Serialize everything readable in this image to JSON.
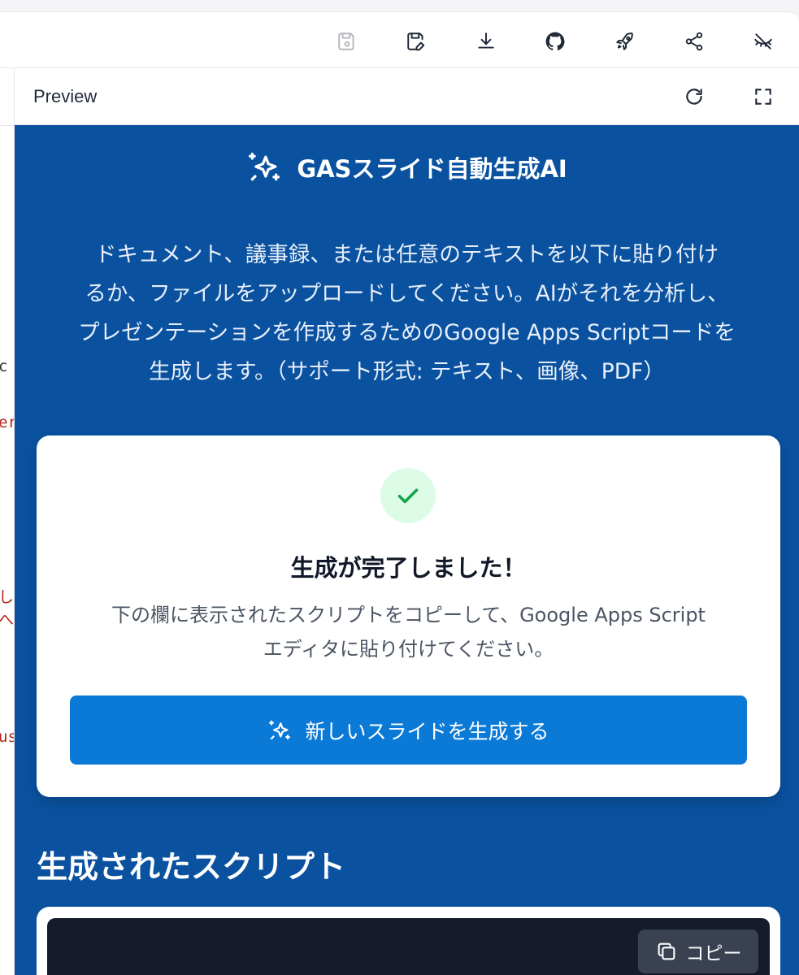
{
  "toolbar": {
    "icons": [
      "save-icon",
      "save-edit-icon",
      "download-icon",
      "github-icon",
      "rocket-icon",
      "share-icon",
      "hide-icon"
    ]
  },
  "left_panel": {
    "fragments": [
      "c",
      "er",
      "し",
      "へ",
      "us"
    ]
  },
  "preview": {
    "title": "Preview"
  },
  "app": {
    "title": "GASスライド自動生成AI",
    "description_lines": [
      "ドキュメント、議事録、または任意のテキストを以下に貼り付け",
      "るか、ファイルをアップロードしてください。AIがそれを分析し、",
      "プレゼンテーションを作成するためのGoogle Apps Scriptコードを",
      "生成します。（サポート形式: テキスト、画像、PDF）"
    ],
    "success_card": {
      "title": "生成が完了しました！",
      "subtitle_lines": [
        "下の欄に表示されたスクリプトをコピーして、Google Apps Script",
        "エディタに貼り付けてください。"
      ],
      "button_label": "新しいスライドを生成する"
    },
    "script_section": {
      "title": "生成されたスクリプト",
      "copy_label": "コピー"
    }
  },
  "colors": {
    "app_background": "#0a52a0",
    "primary_button": "#0b7ad6",
    "success_bg": "#dcfce7",
    "success_check": "#16a34a",
    "code_bg": "#151b2a"
  }
}
